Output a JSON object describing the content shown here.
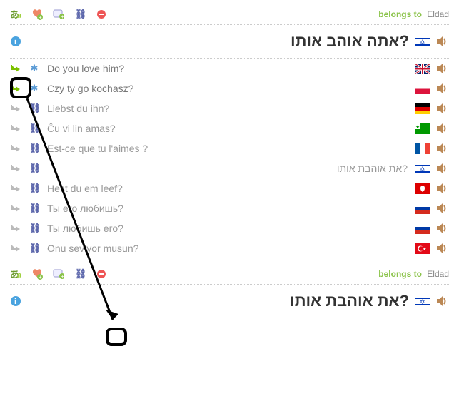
{
  "belongs_label": "belongs to",
  "owner": "Eldad",
  "block1": {
    "main": "?אתה אוהב אותו",
    "main_flag": "israel",
    "translations": [
      {
        "kind": "direct",
        "icon": "star",
        "text": "Do you love him?",
        "flag": "uk",
        "rtl": false
      },
      {
        "kind": "direct",
        "icon": "star",
        "text": "Czy ty go kochasz?",
        "flag": "poland",
        "rtl": false
      },
      {
        "kind": "indirect",
        "icon": "chain",
        "text": "Liebst du ihn?",
        "flag": "germany",
        "rtl": false
      },
      {
        "kind": "indirect",
        "icon": "chain",
        "text": "Ĉu vi lin amas?",
        "flag": "esperanto",
        "rtl": false
      },
      {
        "kind": "indirect",
        "icon": "chain",
        "text": "Est-ce que tu l'aimes ?",
        "flag": "france",
        "rtl": false
      },
      {
        "kind": "indirect",
        "icon": "chain",
        "text": "?את אוהבת אותו",
        "flag": "israel",
        "rtl": true
      },
      {
        "kind": "indirect",
        "icon": "chain",
        "text": "Hest du em leef?",
        "flag": "lowsaxon",
        "rtl": false
      },
      {
        "kind": "indirect",
        "icon": "chain",
        "text": "Ты его любишь?",
        "flag": "russia",
        "rtl": false
      },
      {
        "kind": "indirect",
        "icon": "chain",
        "text": "Ты любишь его?",
        "flag": "russia",
        "rtl": false
      },
      {
        "kind": "indirect",
        "icon": "chain",
        "text": "Onu seviyor musun?",
        "flag": "turkey",
        "rtl": false
      }
    ]
  },
  "block2": {
    "main": "?את אוהבת אותו",
    "main_flag": "israel"
  },
  "colors": {
    "direct": "#7cc100",
    "indirect": "#bbbbbb",
    "belongs": "#8bc34a"
  }
}
